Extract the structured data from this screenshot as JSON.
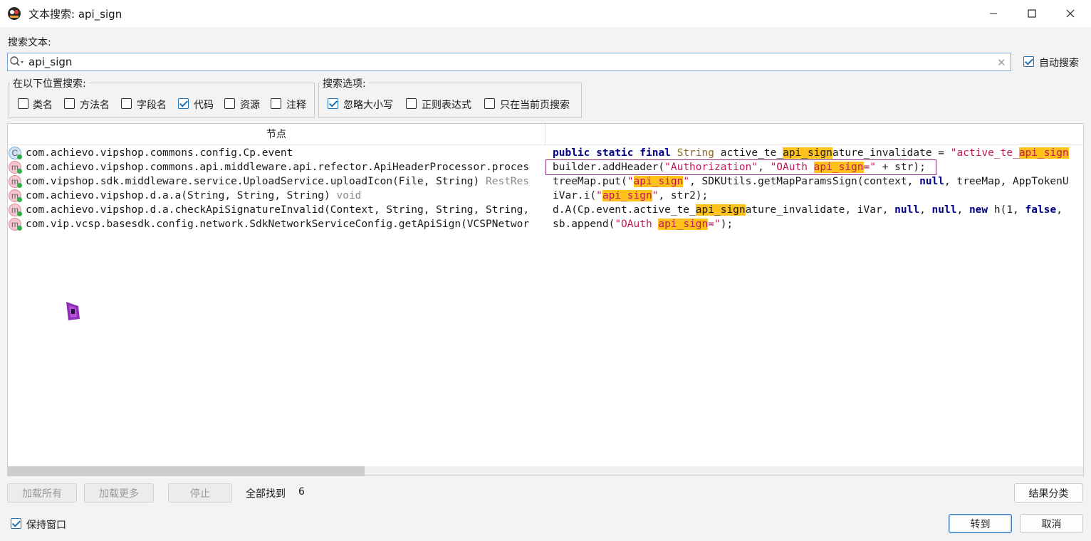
{
  "window": {
    "title": "文本搜索: api_sign",
    "minimize_icon": "minimize-icon",
    "maximize_icon": "maximize-icon",
    "close_icon": "close-icon"
  },
  "search": {
    "label": "搜索文本:",
    "value": "api_sign",
    "auto_search_label": "自动搜索",
    "auto_search_checked": true
  },
  "location_group": {
    "title": "在以下位置搜索:",
    "options": [
      {
        "label": "类名",
        "checked": false
      },
      {
        "label": "方法名",
        "checked": false
      },
      {
        "label": "字段名",
        "checked": false
      },
      {
        "label": "代码",
        "checked": true
      },
      {
        "label": "资源",
        "checked": false
      },
      {
        "label": "注释",
        "checked": false
      }
    ]
  },
  "options_group": {
    "title": "搜索选项:",
    "options": [
      {
        "label": "忽略大小写",
        "checked": true
      },
      {
        "label": "正则表达式",
        "checked": false
      },
      {
        "label": "只在当前页搜索",
        "checked": false
      }
    ]
  },
  "results": {
    "node_header": "节点",
    "rows": [
      {
        "icon": "C",
        "node": "com.achievo.vipshop.commons.config.Cp.event",
        "suffix": ""
      },
      {
        "icon": "m",
        "node": "com.achievo.vipshop.commons.api.middleware.api.refector.ApiHeaderProcessor.proces",
        "suffix": ""
      },
      {
        "icon": "m",
        "node": "com.vipshop.sdk.middleware.service.UploadService.uploadIcon(File, String)",
        "suffix": " RestRes"
      },
      {
        "icon": "m",
        "node": "com.achievo.vipshop.d.a.a(String, String, String)",
        "suffix": " void"
      },
      {
        "icon": "m",
        "node": "com.achievo.vipshop.d.a.checkApiSignatureInvalid(Context, String, String, String,",
        "suffix": ""
      },
      {
        "icon": "m",
        "node": "com.vip.vcsp.basesdk.config.network.SdkNetworkServiceConfig.getApiSign(VCSPNetwor",
        "suffix": ""
      }
    ],
    "code": [
      {
        "parts": [
          [
            "kw",
            "public"
          ],
          [
            "t",
            " "
          ],
          [
            "kw",
            "static"
          ],
          [
            "t",
            " "
          ],
          [
            "kw",
            "final"
          ],
          [
            "t",
            " "
          ],
          [
            "ty",
            "String"
          ],
          [
            "t",
            " active_te_"
          ],
          [
            "hl",
            "api_sign"
          ],
          [
            "t",
            "ature_invalidate = "
          ],
          [
            "st",
            "\"active_te_"
          ],
          [
            "hlst",
            "api_sign"
          ]
        ]
      },
      {
        "parts": [
          [
            "t",
            "builder.addHeader("
          ],
          [
            "st",
            "\"Authorization\""
          ],
          [
            "t",
            ", "
          ],
          [
            "st",
            "\"OAuth "
          ],
          [
            "hlst",
            "api_sign"
          ],
          [
            "st",
            "=\""
          ],
          [
            "t",
            " + str);"
          ]
        ]
      },
      {
        "parts": [
          [
            "t",
            "treeMap.put("
          ],
          [
            "st",
            "\""
          ],
          [
            "hlst",
            "api_sign"
          ],
          [
            "st",
            "\""
          ],
          [
            "t",
            ", SDKUtils.getMapParamsSign(context, "
          ],
          [
            "kw",
            "null"
          ],
          [
            "t",
            ", treeMap, AppTokenU"
          ]
        ]
      },
      {
        "parts": [
          [
            "t",
            "iVar.i("
          ],
          [
            "st",
            "\""
          ],
          [
            "hlst",
            "api_sign"
          ],
          [
            "st",
            "\""
          ],
          [
            "t",
            ", str2);"
          ]
        ]
      },
      {
        "parts": [
          [
            "t",
            "d.A(Cp.event.active_te_"
          ],
          [
            "hl",
            "api_sign"
          ],
          [
            "t",
            "ature_invalidate, iVar, "
          ],
          [
            "kw",
            "null"
          ],
          [
            "t",
            ", "
          ],
          [
            "kw",
            "null"
          ],
          [
            "t",
            ", "
          ],
          [
            "kw",
            "new"
          ],
          [
            "t",
            " h(1, "
          ],
          [
            "kw",
            "false"
          ],
          [
            "t",
            ","
          ]
        ]
      },
      {
        "parts": [
          [
            "t",
            "sb.append("
          ],
          [
            "st",
            "\"OAuth "
          ],
          [
            "hlst",
            "api_sign"
          ],
          [
            "st",
            "=\""
          ],
          [
            "t",
            ");"
          ]
        ]
      }
    ]
  },
  "footer": {
    "load_all": "加载所有",
    "load_more": "加载更多",
    "stop": "停止",
    "found_text": "全部找到",
    "found_count": "6",
    "classify": "结果分类",
    "keep_window": "保持窗口",
    "keep_window_checked": true,
    "goto": "转到",
    "cancel": "取消"
  }
}
